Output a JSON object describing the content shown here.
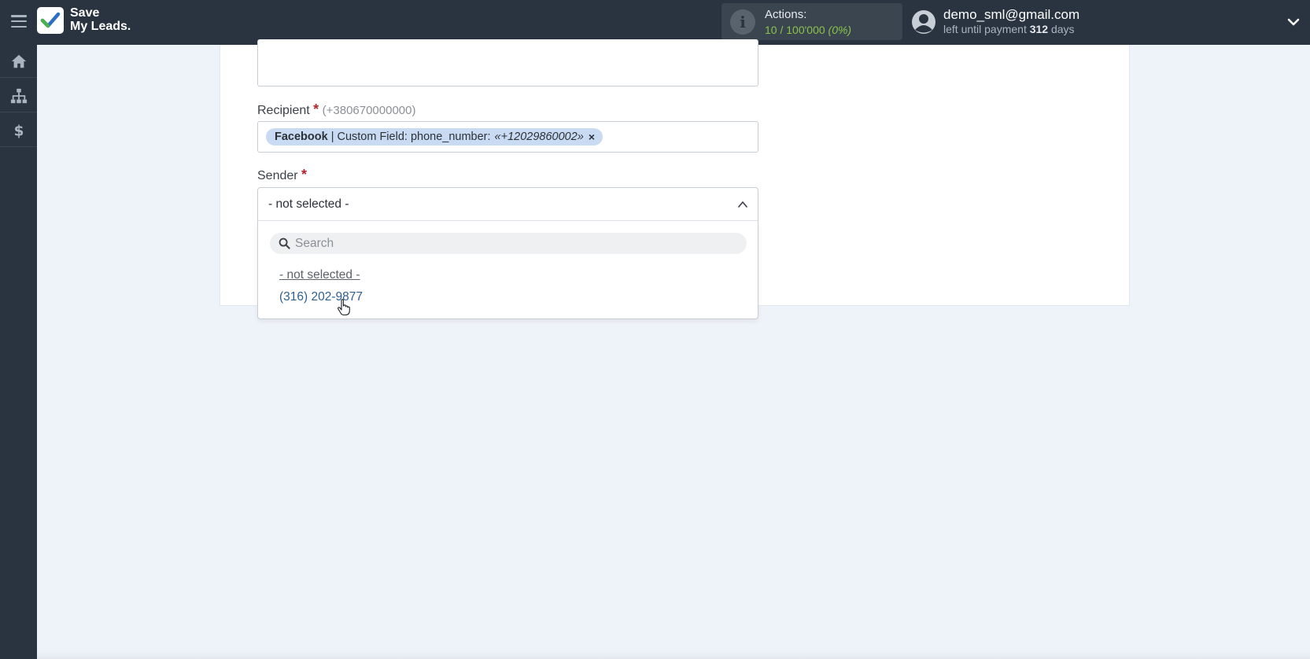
{
  "app": {
    "logo_line1": "Save",
    "logo_line2": "My Leads."
  },
  "header": {
    "actions_label": "Actions:",
    "actions_used": "10",
    "actions_sep": " / ",
    "actions_total": "100'000",
    "actions_pct": "(0%)",
    "user_email": "demo_sml@gmail.com",
    "payment_prefix": "left until payment",
    "payment_days": "312",
    "payment_suffix": "days"
  },
  "sidebar": {
    "items": [
      {
        "icon": "home-icon"
      },
      {
        "icon": "sitemap-icon"
      },
      {
        "icon": "dollar-icon"
      }
    ]
  },
  "form": {
    "recipient": {
      "label": "Recipient",
      "required_mark": "*",
      "hint": "(+380670000000)",
      "chip_source": "Facebook",
      "chip_sep": "|",
      "chip_field": "Custom Field: phone_number:",
      "chip_value": "«+12029860002»",
      "chip_remove": "×"
    },
    "sender": {
      "label": "Sender",
      "required_mark": "*",
      "selected": "- not selected -",
      "search_placeholder": "Search",
      "options": [
        "- not selected -",
        "(316) 202-9877"
      ]
    }
  },
  "colors": {
    "topbar": "#2a3440",
    "background": "#eef2f9",
    "accent_green": "#8bc34a",
    "chip": "#c9dbf2",
    "required": "#b3262e",
    "link": "#2f5f8f"
  }
}
